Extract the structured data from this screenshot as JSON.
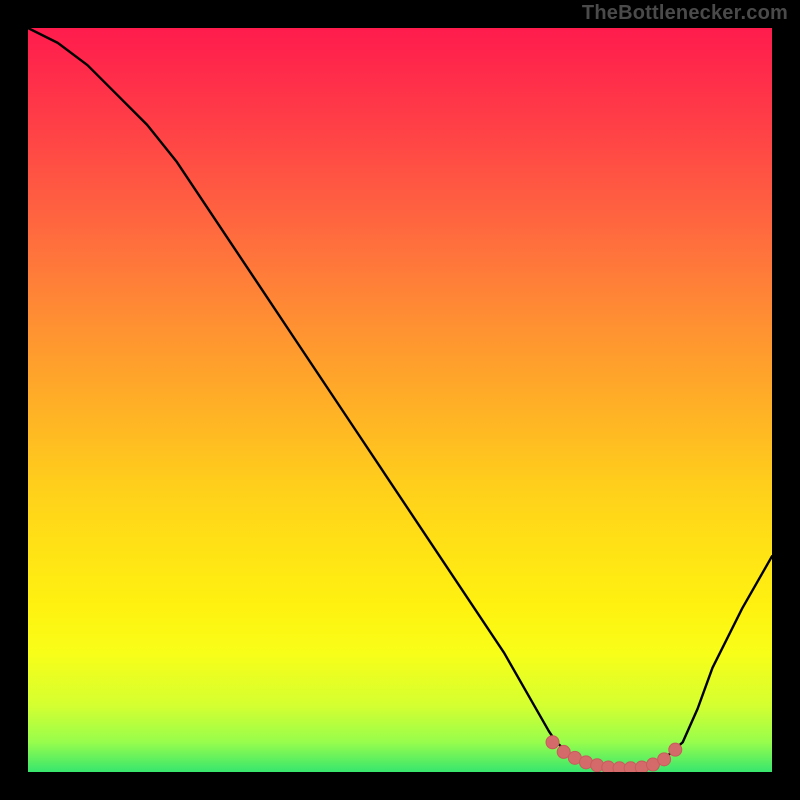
{
  "watermark": "TheBottlenecker.com",
  "colors": {
    "frame_background": "#000000",
    "curve": "#000000",
    "marker_fill": "#d56a6a",
    "marker_stroke": "#c85c5c"
  },
  "chart_data": {
    "type": "line",
    "title": "",
    "xlabel": "",
    "ylabel": "",
    "xlim": [
      0,
      100
    ],
    "ylim": [
      0,
      100
    ],
    "series": [
      {
        "name": "bottleneck-curve",
        "x": [
          0,
          4,
          8,
          12,
          16,
          20,
          24,
          28,
          32,
          36,
          40,
          44,
          48,
          52,
          56,
          60,
          64,
          68,
          70,
          71,
          73,
          75,
          77,
          79,
          81,
          83,
          85,
          86,
          88,
          90,
          92,
          96,
          100
        ],
        "y": [
          100,
          98,
          95,
          91,
          87,
          82,
          76,
          70,
          64,
          58,
          52,
          46,
          40,
          34,
          28,
          22,
          16,
          9,
          5.5,
          4,
          2.3,
          1.3,
          0.8,
          0.5,
          0.5,
          0.7,
          1.4,
          2.2,
          4,
          8.5,
          14,
          22,
          29
        ]
      }
    ],
    "markers": {
      "name": "highlight-points",
      "x": [
        70.5,
        72,
        73.5,
        75,
        76.5,
        78,
        79.5,
        81,
        82.5,
        84,
        85.5,
        87
      ],
      "y": [
        4.0,
        2.7,
        1.9,
        1.3,
        0.9,
        0.6,
        0.5,
        0.5,
        0.6,
        1.0,
        1.7,
        3.0
      ]
    },
    "gradient_stops": [
      {
        "pos": 0.0,
        "color": "#ff1c4d"
      },
      {
        "pos": 0.14,
        "color": "#ff4246"
      },
      {
        "pos": 0.3,
        "color": "#ff723c"
      },
      {
        "pos": 0.46,
        "color": "#ffa22b"
      },
      {
        "pos": 0.62,
        "color": "#ffd01b"
      },
      {
        "pos": 0.78,
        "color": "#fff210"
      },
      {
        "pos": 0.91,
        "color": "#d5ff30"
      },
      {
        "pos": 1.0,
        "color": "#37e66e"
      }
    ]
  }
}
